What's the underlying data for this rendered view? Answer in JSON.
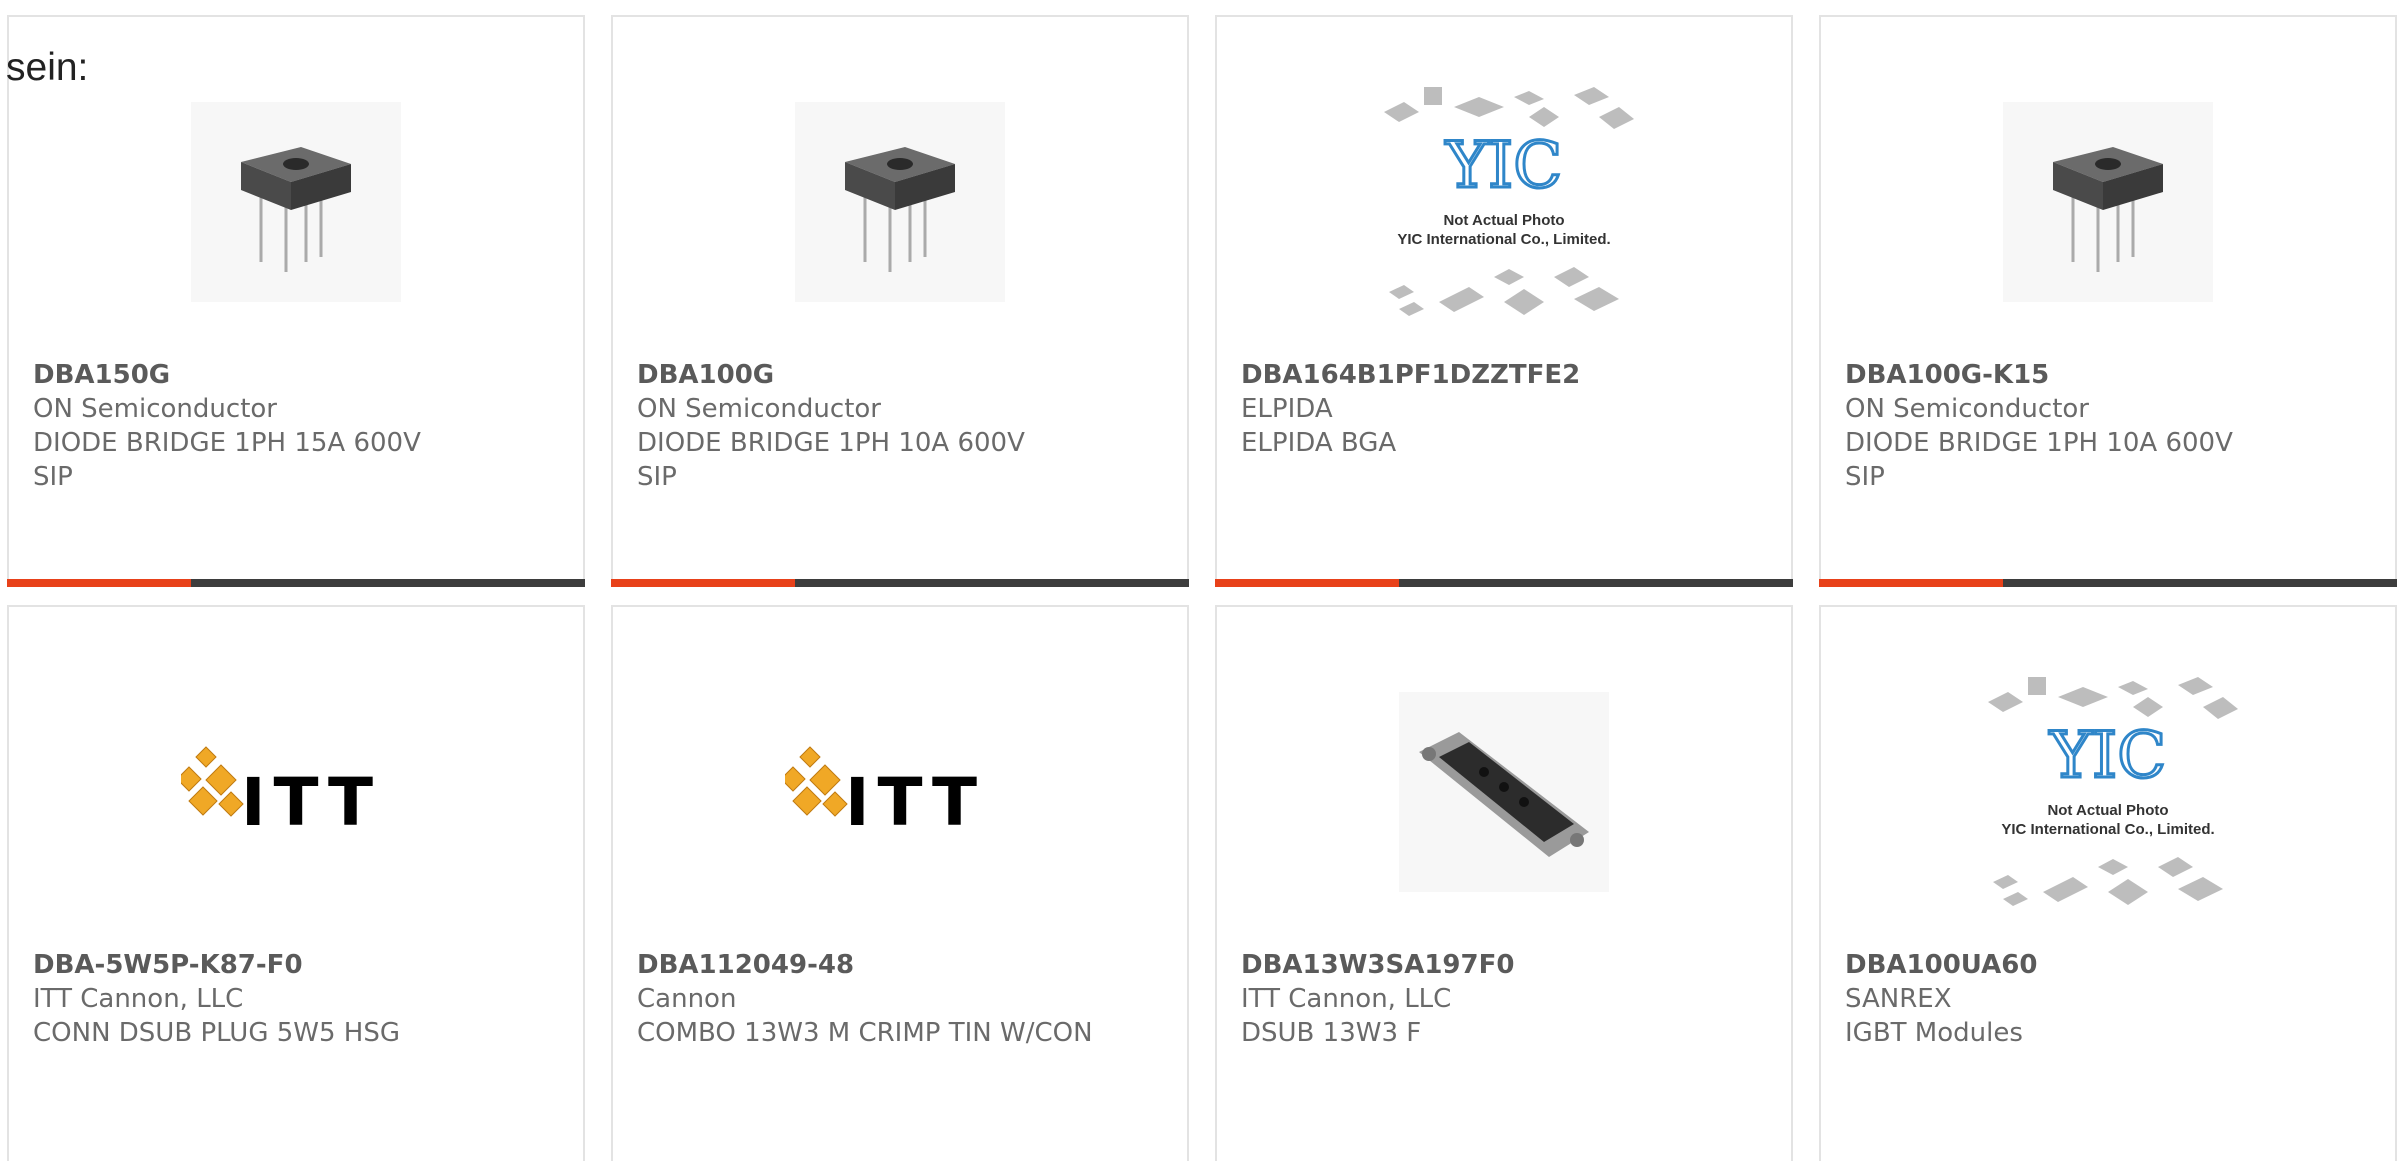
{
  "intro_text": "sein:",
  "colors": {
    "accent": "#e8411a",
    "bar": "#3d3d3d",
    "border": "#e3e3e3",
    "text": "#6a6a6a"
  },
  "cards": [
    {
      "part": "DBA150G",
      "maker": "ON Semiconductor",
      "desc": "DIODE BRIDGE 1PH 15A 600V",
      "package": "SIP",
      "image": "diode-bridge-image"
    },
    {
      "part": "DBA100G",
      "maker": "ON Semiconductor",
      "desc": "DIODE BRIDGE 1PH 10A 600V",
      "package": "SIP",
      "image": "diode-bridge-image"
    },
    {
      "part": "DBA164B1PF1DZZTFE2",
      "maker": "ELPIDA",
      "desc": "ELPIDA BGA",
      "image": "placeholder-not-actual-photo"
    },
    {
      "part": "DBA100G-K15",
      "maker": "ON Semiconductor",
      "desc": "DIODE BRIDGE 1PH 10A 600V",
      "package": "SIP",
      "image": "diode-bridge-image"
    },
    {
      "part": "DBA-5W5P-K87-F0",
      "maker": "ITT Cannon, LLC",
      "desc": "CONN DSUB PLUG 5W5 HSG",
      "image": "itt-logo"
    },
    {
      "part": "DBA112049-48",
      "maker": "Cannon",
      "desc": "COMBO 13W3 M CRIMP TIN W/CON",
      "image": "itt-logo"
    },
    {
      "part": "DBA13W3SA197F0",
      "maker": "ITT Cannon, LLC",
      "desc": "DSUB 13W3 F",
      "image": "dsub-connector-image"
    },
    {
      "part": "DBA100UA60",
      "maker": "SANREX",
      "desc": "IGBT Modules",
      "image": "placeholder-not-actual-photo"
    }
  ],
  "placeholder": {
    "line1": "Not Actual Photo",
    "line2": "YIC International Co., Limited.",
    "logo": "YIC"
  },
  "itt_logo_text": "ITT"
}
